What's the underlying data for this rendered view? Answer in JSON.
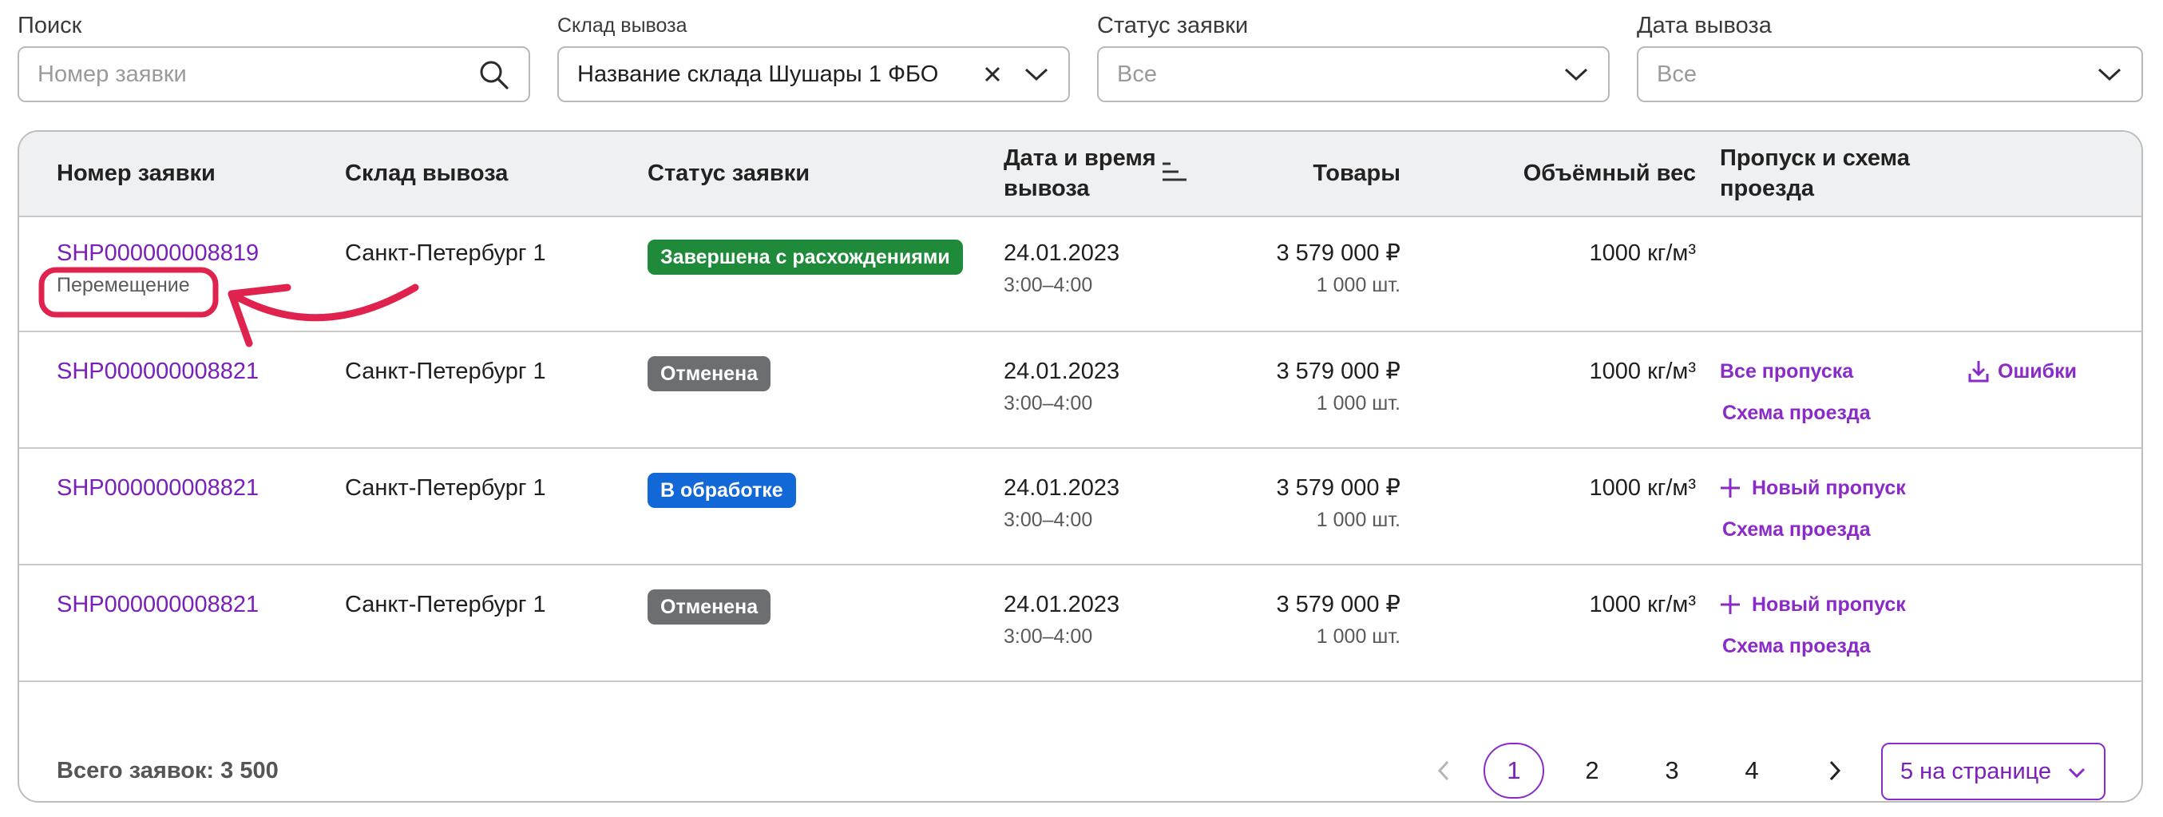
{
  "filters": {
    "search": {
      "label": "Поиск",
      "placeholder": "Номер заявки",
      "icon": "search-icon"
    },
    "warehouse": {
      "label": "Склад вывоза",
      "value": "Название склада Шушары 1 ФБО"
    },
    "status": {
      "label": "Статус заявки",
      "value": "Все"
    },
    "date": {
      "label": "Дата вывоза",
      "value": "Все"
    }
  },
  "table": {
    "columns": {
      "number": "Номер заявки",
      "warehouse": "Склад вывоза",
      "status": "Статус заявки",
      "datetime_line1": "Дата и время",
      "datetime_line2": "вывоза",
      "goods": "Товары",
      "weight": "Объёмный вес",
      "pass_line1": "Пропуск и схема",
      "pass_line2": "проезда"
    },
    "rows": [
      {
        "number": "SHP000000008819",
        "note": "Перемещение",
        "warehouse": "Санкт-Петербург 1",
        "status": "Завершена с расхождениями",
        "date": "24.01.2023",
        "time": "3:00–4:00",
        "price": "3 579 000 ₽",
        "qty": "1 000 шт.",
        "weight": "1000 кг/м³"
      },
      {
        "number": "SHP000000008821",
        "warehouse": "Санкт-Петербург 1",
        "status": "Отменена",
        "date": "24.01.2023",
        "time": "3:00–4:00",
        "price": "3 579 000 ₽",
        "qty": "1 000 шт.",
        "weight": "1000 кг/м³",
        "pass_link": "Все пропуска",
        "scheme_link": "Схема проезда",
        "errors_link": "Ошибки"
      },
      {
        "number": "SHP000000008821",
        "warehouse": "Санкт-Петербург 1",
        "status": "В обработке",
        "date": "24.01.2023",
        "time": "3:00–4:00",
        "price": "3 579 000 ₽",
        "qty": "1 000 шт.",
        "weight": "1000 кг/м³",
        "pass_link": "Новый пропуск",
        "scheme_link": "Схема проезда"
      },
      {
        "number": "SHP000000008821",
        "warehouse": "Санкт-Петербург 1",
        "status": "Отменена",
        "date": "24.01.2023",
        "time": "3:00–4:00",
        "price": "3 579 000 ₽",
        "qty": "1 000 шт.",
        "weight": "1000 кг/м³",
        "pass_link": "Новый пропуск",
        "scheme_link": "Схема проезда"
      }
    ]
  },
  "footer": {
    "total": "Всего заявок: 3 500",
    "pages": [
      "1",
      "2",
      "3",
      "4"
    ],
    "current_page": "1",
    "per_page": "5 на странице"
  },
  "colors": {
    "accent": "#8a2bc7",
    "status_done_discrepancy": "#1e8a3a",
    "status_cancelled": "#6b6f72",
    "status_processing": "#1268d6",
    "annotation": "#e0234e"
  }
}
